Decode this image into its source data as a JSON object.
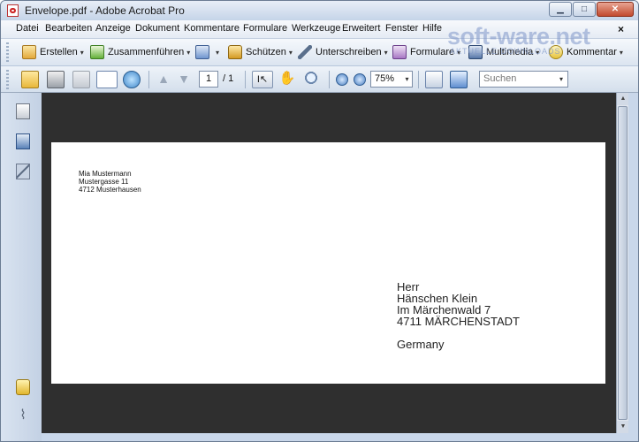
{
  "window": {
    "title": "Envelope.pdf - Adobe Acrobat Pro"
  },
  "menu": {
    "items": [
      "Datei",
      "Bearbeiten",
      "Anzeige",
      "Dokument",
      "Kommentare",
      "Formulare",
      "Werkzeuge",
      "Erweitert",
      "Fenster",
      "Hilfe"
    ],
    "close_glyph": "×"
  },
  "toolbar1": {
    "erstellen": "Erstellen",
    "zusammenfuehren": "Zusammenführen",
    "schuetzen": "Schützen",
    "unterschreiben": "Unterschreiben",
    "formulare": "Formulare",
    "multimedia": "Multimedia",
    "kommentar": "Kommentar",
    "caret": "▾"
  },
  "toolbar2": {
    "page_current": "1",
    "page_total": "/ 1",
    "zoom": "75%",
    "search_placeholder": "Suchen",
    "caret": "▾"
  },
  "document": {
    "sender": [
      "Mia Mustermann",
      "Mustergasse 11",
      "4712 Musterhausen"
    ],
    "recipient": [
      "Herr",
      "Hänschen Klein",
      "Im Märchenwald 7",
      "4711 MÄRCHENSTADT"
    ],
    "country": "Germany"
  },
  "watermark": {
    "brand": "soft-ware.net",
    "sub": "AKTUELLE DOWNLOADS"
  },
  "colors": {
    "doc_background": "#2f2f2f",
    "window_frame": "#c9d7ea",
    "accent_red": "#c22222"
  }
}
